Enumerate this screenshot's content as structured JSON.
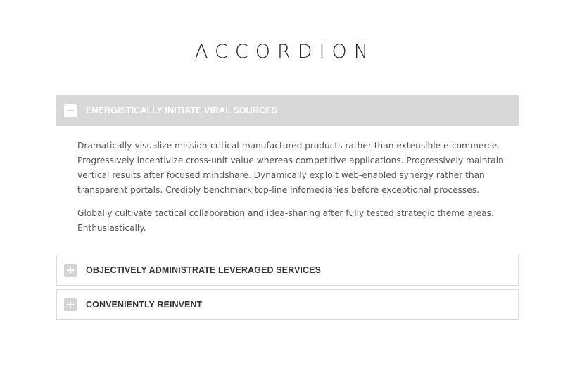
{
  "page": {
    "title": "ACCORDION"
  },
  "accordion": {
    "items": [
      {
        "title": "ENERGISTICALLY INITIATE VIRAL SOURCES",
        "state": "expanded",
        "icon": "minus-icon",
        "paragraphs": [
          "Dramatically visualize mission-critical manufactured products rather than extensible e-commerce. Progressively incentivize cross-unit value whereas competitive applications. Progressively maintain vertical results after focused mindshare. Dynamically exploit web-enabled synergy rather than transparent portals. Credibly benchmark top-line infomediaries before exceptional processes.",
          "Globally cultivate tactical collaboration and idea-sharing after fully tested strategic theme areas. Enthusiastically."
        ]
      },
      {
        "title": "OBJECTIVELY ADMINISTRATE LEVERAGED SERVICES",
        "state": "collapsed",
        "icon": "plus-icon"
      },
      {
        "title": "CONVENIENTLY REINVENT",
        "state": "collapsed",
        "icon": "plus-icon"
      }
    ]
  },
  "colors": {
    "active_header_bg": "#d8d8d8",
    "title_text": "#222222",
    "body_text": "#555555",
    "border": "#dcdcdc"
  }
}
